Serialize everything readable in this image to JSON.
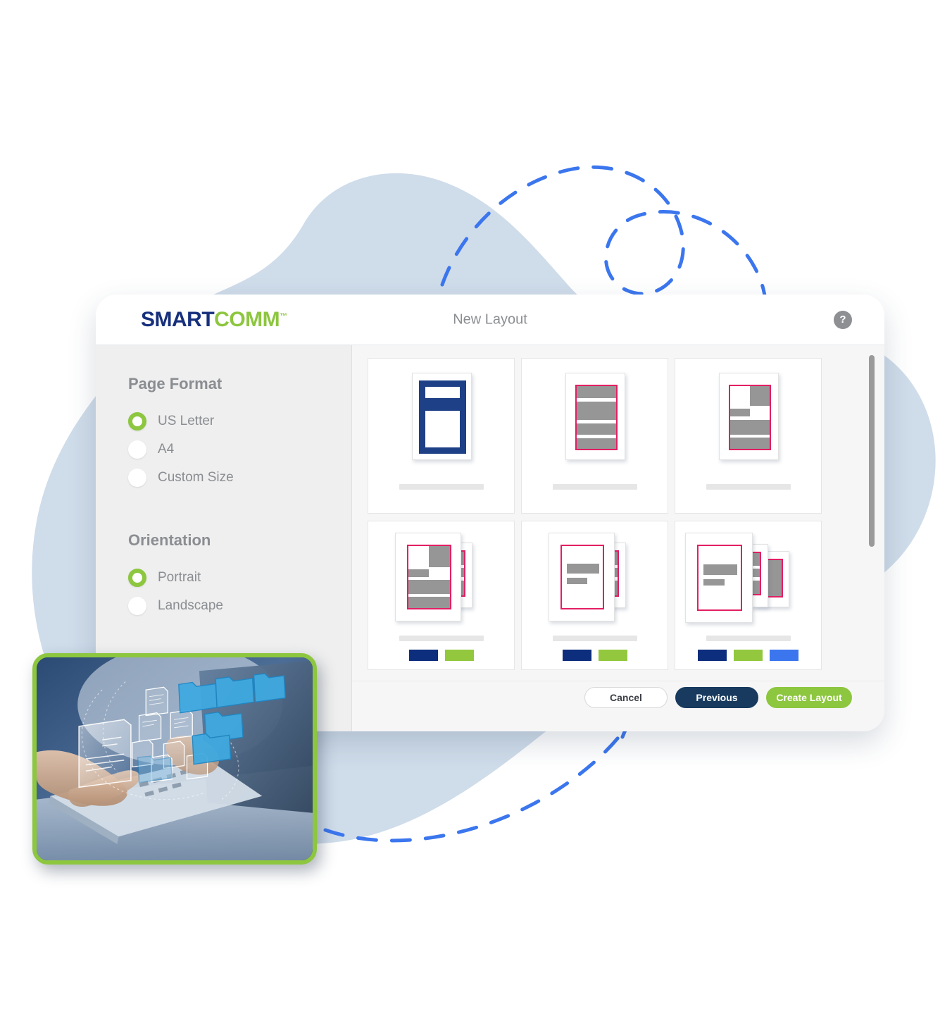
{
  "window": {
    "title": "New Layout",
    "help_icon": "question-mark-icon",
    "help_label": "?"
  },
  "brand": {
    "name_part1": "SMART",
    "name_part2": "COMM",
    "trademark": "™",
    "color_primary": "#17307d",
    "color_accent": "#8dc63f"
  },
  "sidebar": {
    "groups": [
      {
        "heading": "Page Format",
        "options": [
          {
            "label": "US Letter",
            "selected": true
          },
          {
            "label": "A4",
            "selected": false
          },
          {
            "label": "Custom Size",
            "selected": false
          }
        ]
      },
      {
        "heading": "Orientation",
        "options": [
          {
            "label": "Portrait",
            "selected": true
          },
          {
            "label": "Landscape",
            "selected": false
          }
        ]
      }
    ]
  },
  "layout_gallery": {
    "scrollbar": {
      "visible": true,
      "thumb_position": "top"
    },
    "cards": [
      {
        "id": "card-1",
        "style": "navy-frame-two-pane",
        "pages": 1,
        "chips": []
      },
      {
        "id": "card-2",
        "style": "pink-outline-four-bands",
        "pages": 1,
        "chips": []
      },
      {
        "id": "card-3",
        "style": "pink-outline-mixed-blocks",
        "pages": 1,
        "chips": []
      },
      {
        "id": "card-4",
        "style": "two-page-mixed-blocks",
        "pages": 2,
        "chips": [
          "#0d2d7d",
          "#93c83e"
        ]
      },
      {
        "id": "card-5",
        "style": "two-page-header-bars",
        "pages": 2,
        "chips": [
          "#0d2d7d",
          "#93c83e"
        ]
      },
      {
        "id": "card-6",
        "style": "three-page-header-bars",
        "pages": 3,
        "chips": [
          "#0d2d7d",
          "#93c83e",
          "#3b76ee"
        ]
      }
    ]
  },
  "footer": {
    "cancel_label": "Cancel",
    "previous_label": "Previous",
    "create_label": "Create Layout"
  },
  "inset_photo": {
    "alt": "Hands typing on a laptop with floating document and folder holograms",
    "border_color": "#8dc63f"
  },
  "colors": {
    "navy": "#1e4086",
    "pink": "#e31e63",
    "gray_block": "#969696",
    "green": "#8dc63f",
    "dark_navy_button": "#173a5e",
    "blob": "#cfdcea",
    "dashed_path": "#3b76ee"
  }
}
